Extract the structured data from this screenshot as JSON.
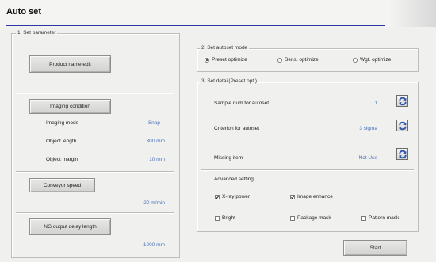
{
  "window": {
    "title": "Auto set"
  },
  "left_panel": {
    "group_label": "1. Set parameter",
    "product_name_button": "Product name edit",
    "imaging_condition_button": "Imaging condition",
    "rows": [
      {
        "label": "Imaging mode",
        "value": "Snap"
      },
      {
        "label": "Object length",
        "value": "300 mm"
      },
      {
        "label": "Object margin",
        "value": "10 mm"
      }
    ],
    "conveyor_speed_button": "Conveyor speed",
    "conveyor_speed_value": "20 m/min",
    "ng_output_button": "NG output delay length",
    "ng_output_value": "1000 mm"
  },
  "autoset_mode": {
    "group_label": "2. Set autoset mode",
    "options": [
      {
        "label": "Preset optimize",
        "selected": true
      },
      {
        "label": "Sens. optimize",
        "selected": false
      },
      {
        "label": "Wgt. optimize",
        "selected": false
      }
    ]
  },
  "set_detail": {
    "group_label": "3. Set detail(Preset opt.)",
    "rows": [
      {
        "label": "Sample num for autoset",
        "value": "1"
      },
      {
        "label": "Criterion for autoset",
        "value": "3 sigma"
      },
      {
        "label": "Missing item",
        "value": "Not Use"
      }
    ],
    "advanced_label": "Advanced setting",
    "checkboxes": [
      {
        "label": "X-ray power",
        "checked": true
      },
      {
        "label": "Image enhance",
        "checked": true
      },
      {
        "label": "Bright",
        "checked": false
      },
      {
        "label": "Package mask",
        "checked": false
      },
      {
        "label": "Pattern mask",
        "checked": false
      }
    ]
  },
  "start_button": "Start",
  "colors": {
    "accent_underline": "#2b36a0",
    "value_text": "#4a72b8",
    "refresh_icon": "#2e55a8"
  },
  "icons": [
    "refresh-icon"
  ]
}
